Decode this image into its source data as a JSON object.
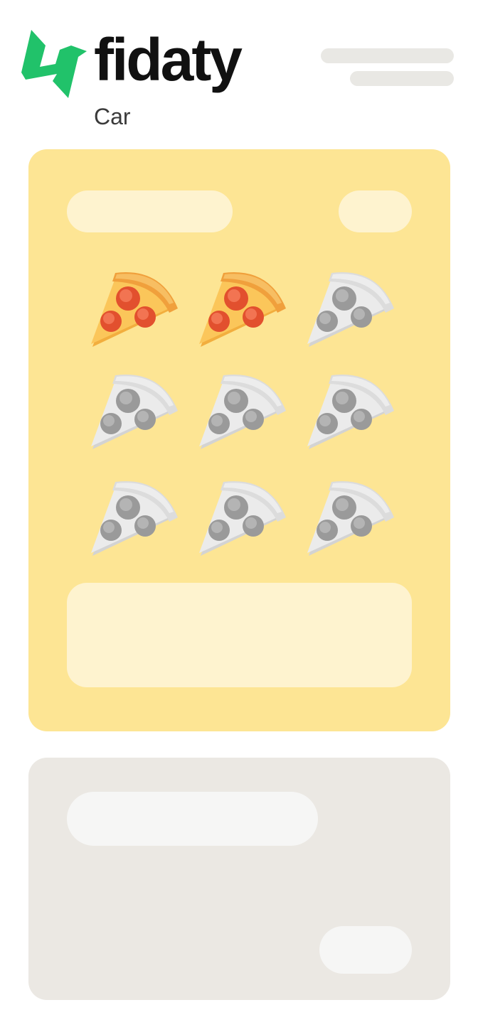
{
  "brand": {
    "name": "fidaty",
    "subtitle": "Car",
    "accent": "#21C26A",
    "logo_icon": "fidaty-logo-icon"
  },
  "header": {
    "menu_icon": "menu-icon",
    "menu_color": "#E9E8E4"
  },
  "stamp_card": {
    "background": "#FDE594",
    "stamp_icon": "pizza-slice-icon",
    "stamps_total": 9,
    "stamps_collected": 2,
    "stamps": [
      {
        "state": "collected"
      },
      {
        "state": "collected"
      },
      {
        "state": "empty"
      },
      {
        "state": "empty"
      },
      {
        "state": "empty"
      },
      {
        "state": "empty"
      },
      {
        "state": "empty"
      },
      {
        "state": "empty"
      },
      {
        "state": "empty"
      }
    ]
  },
  "secondary_card": {
    "background": "#EBE8E3"
  }
}
